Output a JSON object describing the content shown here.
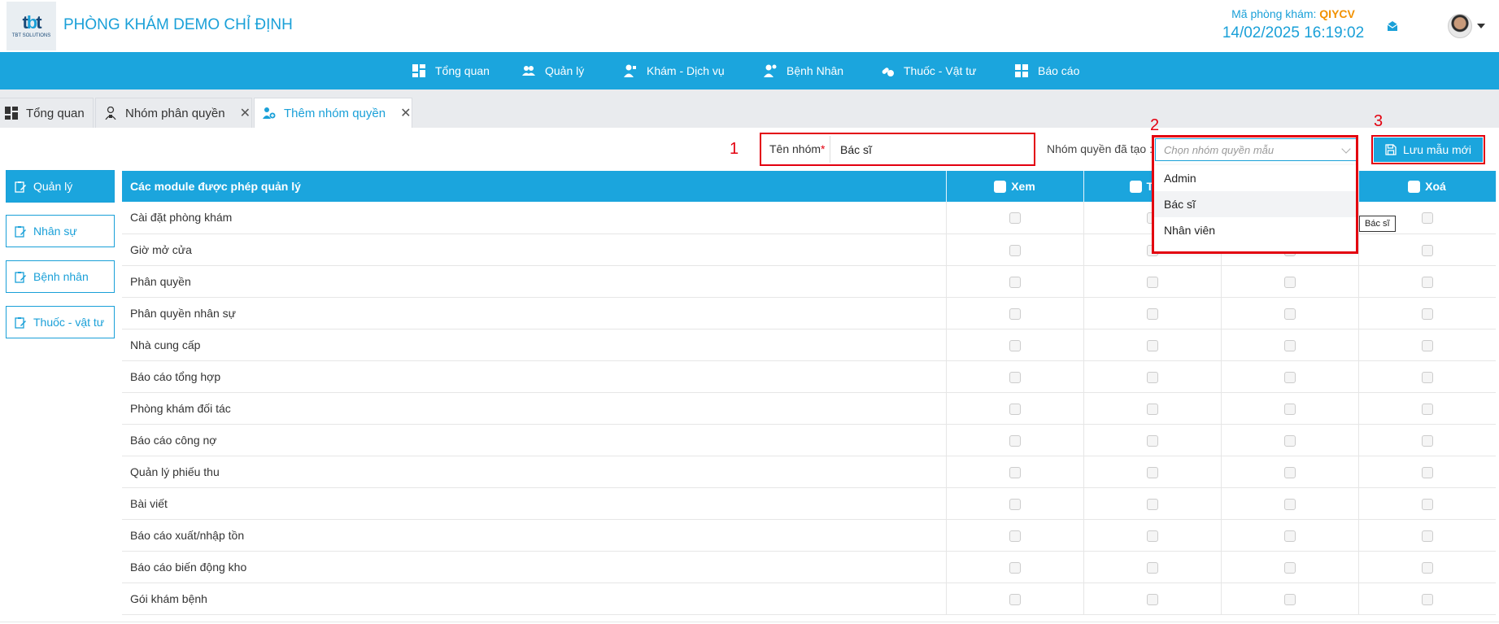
{
  "header": {
    "logo_text": "TBT SOLUTIONS",
    "clinic_title": "PHÒNG KHÁM DEMO CHỈ ĐỊNH",
    "clinic_code_label": "Mã phòng khám: ",
    "clinic_code_value": "QIYCV",
    "datetime": "14/02/2025 16:19:02"
  },
  "nav": {
    "items": [
      {
        "label": "Tổng quan",
        "icon": "dashboard-icon"
      },
      {
        "label": "Quản lý",
        "icon": "users-icon"
      },
      {
        "label": "Khám - Dịch vụ",
        "icon": "doctor-icon"
      },
      {
        "label": "Bệnh Nhân",
        "icon": "patient-icon"
      },
      {
        "label": "Thuốc - Vật tư",
        "icon": "pills-icon"
      },
      {
        "label": "Báo cáo",
        "icon": "report-icon"
      }
    ]
  },
  "tabs": [
    {
      "label": "Tổng quan",
      "closable": false
    },
    {
      "label": "Nhóm phân quyền",
      "closable": true
    },
    {
      "label": "Thêm nhóm quyền",
      "closable": true,
      "active": true
    }
  ],
  "toolbar": {
    "anno_1": "1",
    "anno_2": "2",
    "anno_3": "3",
    "group_name_label": "Tên nhóm",
    "required_mark": "*",
    "group_name_value": "Bác sĩ",
    "trained_group_label": "Nhóm quyền đã tạo :",
    "select_placeholder": "Chọn nhóm quyền mẫu",
    "dropdown_options": [
      "Admin",
      "Bác sĩ",
      "Nhân viên"
    ],
    "tooltip": "Bác sĩ",
    "save_label": "Lưu mẫu mới"
  },
  "sidebar": {
    "items": [
      "Quản lý",
      "Nhân sự",
      "Bệnh nhân",
      "Thuốc - vật tư"
    ]
  },
  "table": {
    "headers": [
      "Các module được phép quản lý",
      "Xem",
      "T",
      "",
      "Xoá"
    ],
    "rows": [
      "Cài đặt phòng khám",
      "Giờ mở cửa",
      "Phân quyền",
      "Phân quyền nhân sự",
      "Nhà cung cấp",
      "Báo cáo tổng hợp",
      "Phòng khám đối tác",
      "Báo cáo công nợ",
      "Quản lý phiếu thu",
      "Bài viết",
      "Báo cáo xuất/nhập tồn",
      "Báo cáo biến động kho",
      "Gói khám bệnh"
    ]
  },
  "colors": {
    "primary": "#1ba5dd",
    "accent": "#f29100",
    "annotation": "#e3000f"
  }
}
